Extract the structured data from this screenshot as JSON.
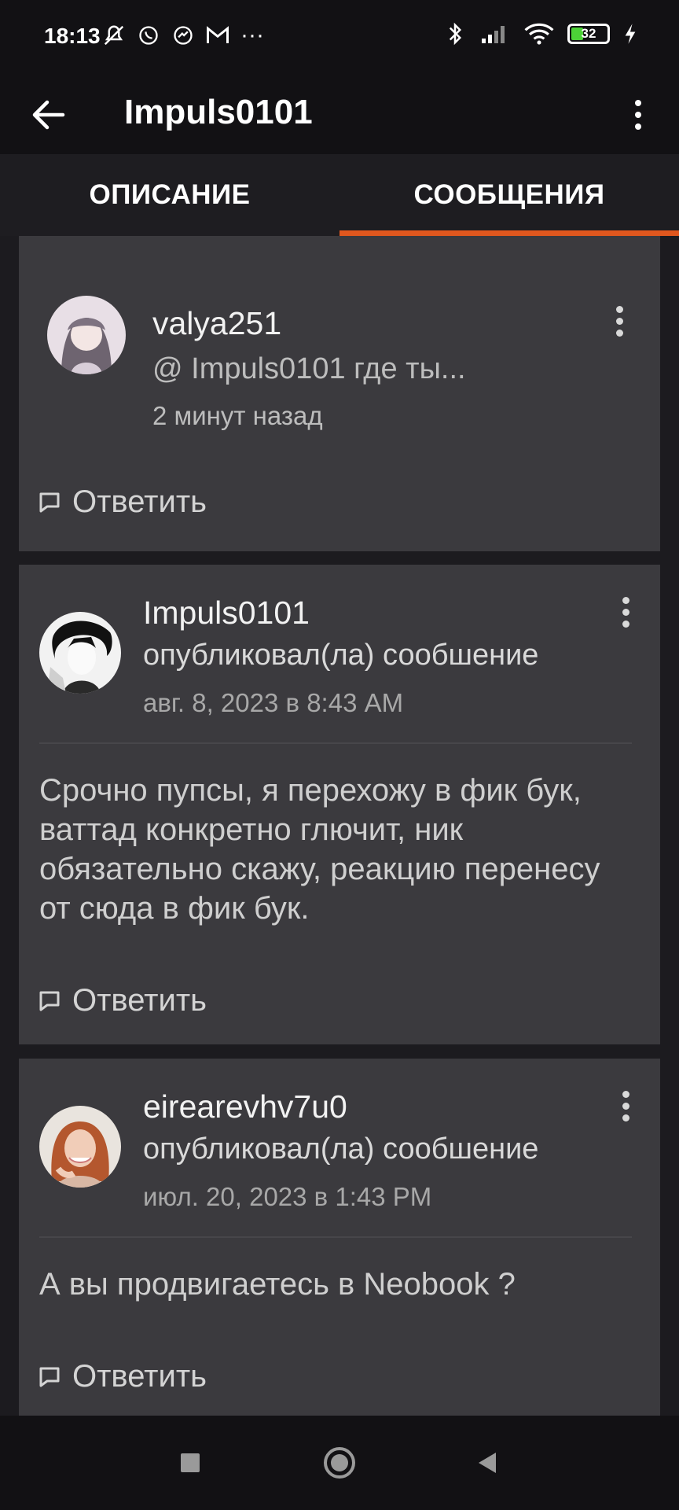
{
  "status_bar": {
    "time": "18:13",
    "battery": "32",
    "icons_left": [
      "mute-icon",
      "whatsapp-icon",
      "messenger-icon",
      "gmail-icon",
      "more-notifications-icon"
    ],
    "icons_right": [
      "bluetooth-icon",
      "signal-icon",
      "wifi-icon",
      "battery-icon",
      "charging-icon"
    ],
    "more_notifications": "···"
  },
  "app_bar": {
    "title": "Impuls0101"
  },
  "tabs": [
    {
      "label": "ОПИСАНИЕ",
      "active": false
    },
    {
      "label": "СООБЩЕНИЯ",
      "active": true
    }
  ],
  "colors": {
    "accent": "#e0571e",
    "card_bg": "#3b3a3e",
    "page_bg": "#1c1b1f",
    "bar_bg": "#121114"
  },
  "messages": [
    {
      "author": "valya251",
      "mention": "@ Impuls0101  где ты...",
      "time": "2 минут назад",
      "reply_label": "Ответить"
    },
    {
      "author": "Impuls0101",
      "action": "опубликовал(ла) сообшение",
      "time": "авг. 8, 2023 в 8:43 AM",
      "body": "Срочно пупсы, я перехожу в фик бук, ваттад конкретно глючит, ник обязательно скажу, реакцию перенесу от сюда в фик бук.",
      "reply_label": "Ответить"
    },
    {
      "author": "eirearevhv7u0",
      "action": "опубликовал(ла) сообшение",
      "time": "июл. 20, 2023 в 1:43 PM",
      "body": "А вы продвигаетесь в Neobook ?",
      "reply_label": "Ответить"
    }
  ]
}
